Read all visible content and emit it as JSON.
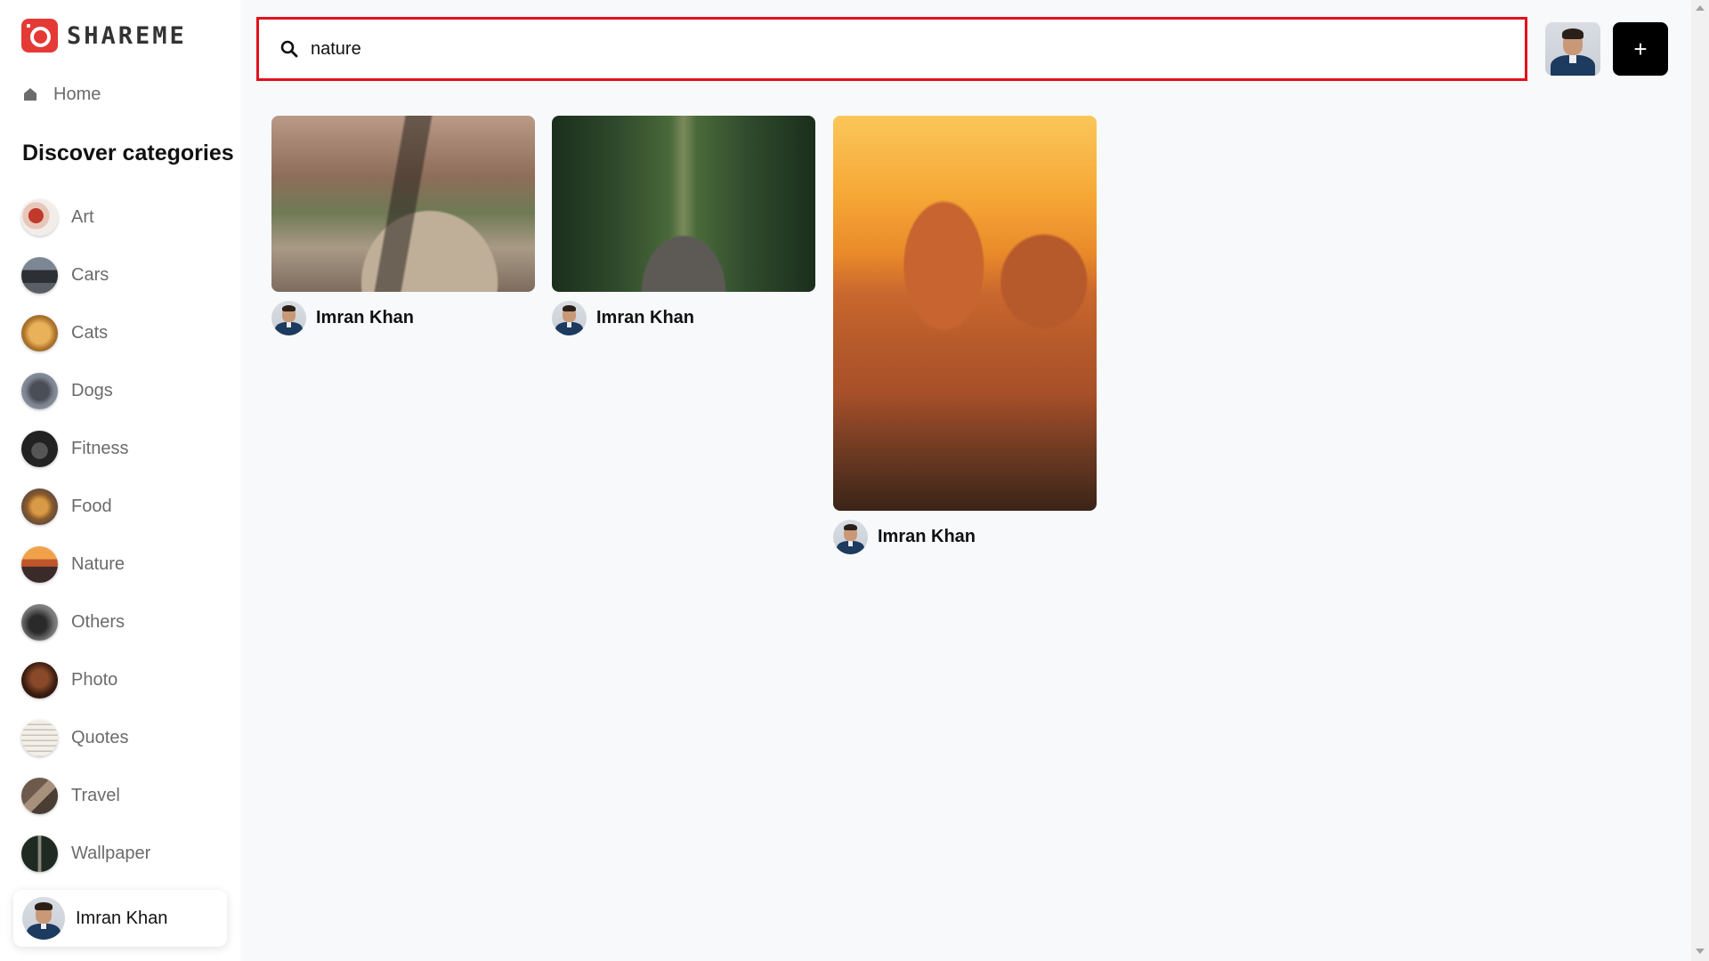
{
  "app": {
    "logo_text": "SHAREME"
  },
  "sidebar": {
    "home_label": "Home",
    "categories_title": "Discover categories",
    "categories": [
      {
        "label": "Art"
      },
      {
        "label": "Cars"
      },
      {
        "label": "Cats"
      },
      {
        "label": "Dogs"
      },
      {
        "label": "Fitness"
      },
      {
        "label": "Food"
      },
      {
        "label": "Nature"
      },
      {
        "label": "Others"
      },
      {
        "label": "Photo"
      },
      {
        "label": "Quotes"
      },
      {
        "label": "Travel"
      },
      {
        "label": "Wallpaper"
      }
    ],
    "profile_name": "Imran Khan"
  },
  "search": {
    "value": "nature",
    "placeholder": ""
  },
  "header": {
    "add_label": "+"
  },
  "pins": [
    {
      "author": "Imran Khan",
      "image": "hiker-canyon-photo"
    },
    {
      "author": "Imran Khan",
      "image": "forest-bridge-photo"
    },
    {
      "author": "Imran Khan",
      "image": "desert-oryx-sunset-photo"
    }
  ]
}
